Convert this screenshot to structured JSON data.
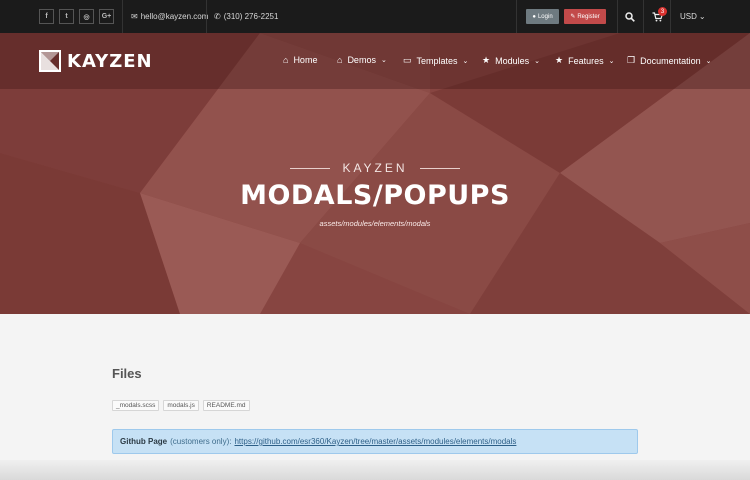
{
  "topbar": {
    "social": [
      {
        "icon": "facebook-icon",
        "glyph": "f"
      },
      {
        "icon": "twitter-icon",
        "glyph": "t"
      },
      {
        "icon": "instagram-icon",
        "glyph": "◎"
      },
      {
        "icon": "google-plus-icon",
        "glyph": "G+"
      }
    ],
    "email": "hello@kayzen.com",
    "phone": "(310) 276-2251",
    "login_label": "Login",
    "register_label": "Register",
    "cart_count": "3",
    "currency": "USD"
  },
  "brand": {
    "name": "KAYZEN"
  },
  "nav": {
    "home": "Home",
    "demos": "Demos",
    "templates": "Templates",
    "modules": "Modules",
    "features": "Features",
    "documentation": "Documentation"
  },
  "hero": {
    "kicker": "KAYZEN",
    "title": "MODALS/POPUPS",
    "path": "assets/modules/elements/modals"
  },
  "content": {
    "files_title": "Files",
    "files": [
      "_modals.scss",
      "modals.js",
      "README.md"
    ],
    "github_label": "Github Page",
    "github_note": "(customers only):",
    "github_url": "https://github.com/esr360/Kayzen/tree/master/assets/modules/elements/modals"
  },
  "colors": {
    "hero_bg": "#8a4844",
    "register": "#c24a4a",
    "login": "#6e7a80",
    "info_bg": "#c6e1f5"
  }
}
